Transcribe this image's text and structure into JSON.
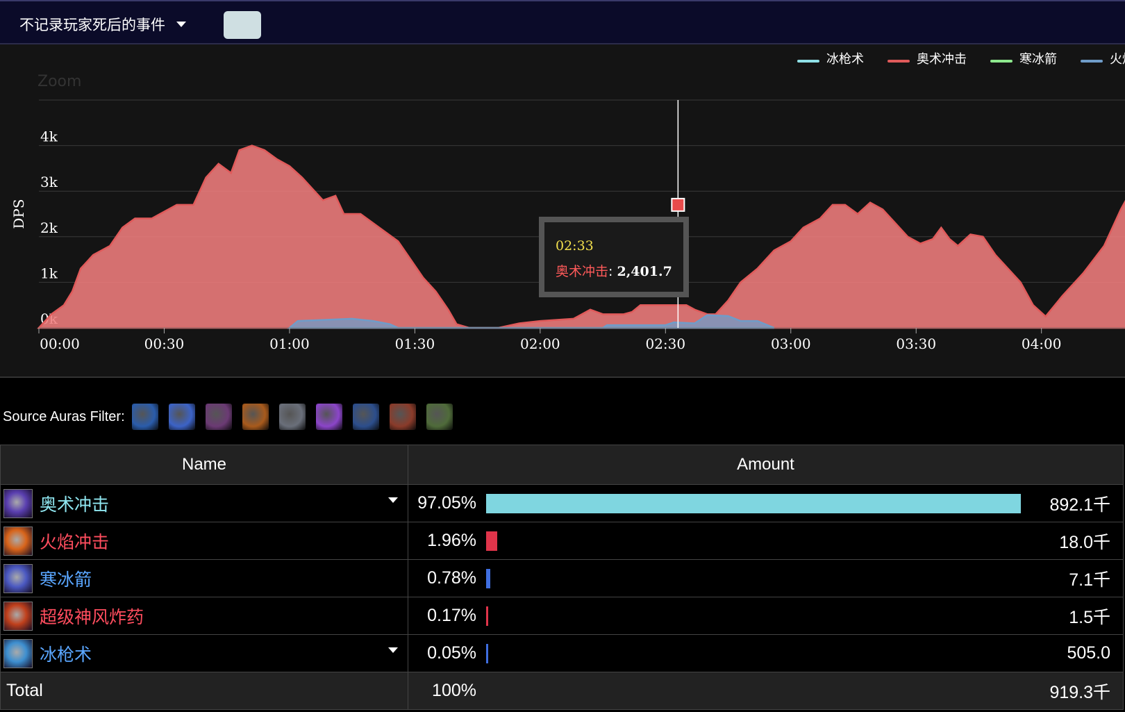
{
  "header": {
    "dropdown_label": "不记录玩家死后的事件"
  },
  "chart_data": {
    "type": "area",
    "zoom_label": "Zoom",
    "ylabel": "DPS",
    "ylim": [
      0,
      5000
    ],
    "yticks": [
      "0k",
      "1k",
      "2k",
      "3k",
      "4k"
    ],
    "xlim": [
      0,
      260
    ],
    "xticks": [
      "00:00",
      "00:30",
      "01:00",
      "01:30",
      "02:00",
      "02:30",
      "03:00",
      "03:30",
      "04:00"
    ],
    "legend_position": "top-right",
    "series": [
      {
        "name": "冰枪术",
        "color": "#8fe0e6",
        "values": []
      },
      {
        "name": "奥术冲击",
        "color": "#e05a5a",
        "points": [
          [
            0,
            0
          ],
          [
            3,
            300
          ],
          [
            6,
            500
          ],
          [
            8,
            800
          ],
          [
            10,
            1300
          ],
          [
            13,
            1600
          ],
          [
            17,
            1800
          ],
          [
            20,
            2200
          ],
          [
            23,
            2400
          ],
          [
            27,
            2400
          ],
          [
            29,
            2500
          ],
          [
            33,
            2700
          ],
          [
            37,
            2700
          ],
          [
            40,
            3300
          ],
          [
            43,
            3600
          ],
          [
            46,
            3400
          ],
          [
            48,
            3900
          ],
          [
            51,
            4000
          ],
          [
            54,
            3900
          ],
          [
            57,
            3700
          ],
          [
            60,
            3550
          ],
          [
            63,
            3300
          ],
          [
            66,
            3000
          ],
          [
            68,
            2800
          ],
          [
            71,
            2900
          ],
          [
            73,
            2500
          ],
          [
            77,
            2500
          ],
          [
            80,
            2300
          ],
          [
            83,
            2100
          ],
          [
            86,
            1900
          ],
          [
            89,
            1500
          ],
          [
            92,
            1100
          ],
          [
            95,
            800
          ],
          [
            98,
            400
          ],
          [
            100,
            80
          ],
          [
            103,
            0
          ],
          [
            110,
            0
          ],
          [
            115,
            100
          ],
          [
            120,
            150
          ],
          [
            128,
            200
          ],
          [
            129,
            250
          ],
          [
            132,
            400
          ],
          [
            135,
            300
          ],
          [
            140,
            300
          ],
          [
            142,
            350
          ],
          [
            144,
            500
          ],
          [
            155,
            500
          ],
          [
            157,
            400
          ],
          [
            160,
            300
          ],
          [
            162,
            300
          ],
          [
            165,
            600
          ],
          [
            168,
            1000
          ],
          [
            172,
            1300
          ],
          [
            176,
            1700
          ],
          [
            180,
            1900
          ],
          [
            183,
            2200
          ],
          [
            187,
            2400
          ],
          [
            190,
            2700
          ],
          [
            193,
            2700
          ],
          [
            196,
            2500
          ],
          [
            199,
            2750
          ],
          [
            202,
            2600
          ],
          [
            205,
            2300
          ],
          [
            208,
            2000
          ],
          [
            211,
            1850
          ],
          [
            214,
            1950
          ],
          [
            216,
            2200
          ],
          [
            218,
            1950
          ],
          [
            220,
            1800
          ],
          [
            223,
            2050
          ],
          [
            226,
            2000
          ],
          [
            229,
            1600
          ],
          [
            232,
            1300
          ],
          [
            235,
            1000
          ],
          [
            238,
            500
          ],
          [
            241,
            250
          ],
          [
            245,
            700
          ],
          [
            250,
            1200
          ],
          [
            255,
            1800
          ],
          [
            259,
            2600
          ],
          [
            262,
            3100
          ],
          [
            265,
            3350
          ],
          [
            268,
            3400
          ],
          [
            271,
            3500
          ],
          [
            274,
            3300
          ],
          [
            277,
            3050
          ],
          [
            281,
            2600
          ],
          [
            285,
            1800
          ],
          [
            288,
            800
          ],
          [
            291,
            300
          ]
        ]
      },
      {
        "name": "寒冰箭",
        "color": "#8ee88e",
        "values": []
      },
      {
        "name": "火焰冲击",
        "color": "#6f9cc9",
        "points": [
          [
            60,
            0
          ],
          [
            62,
            150
          ],
          [
            75,
            200
          ],
          [
            80,
            150
          ],
          [
            84,
            80
          ],
          [
            86,
            0
          ],
          [
            120,
            0
          ],
          [
            135,
            0
          ],
          [
            136,
            60
          ],
          [
            150,
            60
          ],
          [
            152,
            120
          ],
          [
            157,
            100
          ],
          [
            160,
            280
          ],
          [
            165,
            260
          ],
          [
            168,
            150
          ],
          [
            172,
            150
          ],
          [
            176,
            0
          ]
        ]
      }
    ],
    "tooltip": {
      "time": "02:33",
      "series_name": "奥术冲击",
      "value": "2,401.7"
    },
    "cursor_x": 153
  },
  "filter": {
    "label": "Source Auras Filter:",
    "auras": [
      {
        "icon": "frost-rune-icon",
        "color": "#2a5cab"
      },
      {
        "icon": "lightning-bolt-icon",
        "color": "#3c63c7"
      },
      {
        "icon": "priest-portrait-icon",
        "color": "#6b3a74"
      },
      {
        "icon": "flask-icon",
        "color": "#a85a1c"
      },
      {
        "icon": "helmet-icon",
        "color": "#6a6f7a"
      },
      {
        "icon": "purple-beam-icon",
        "color": "#8b45c9"
      },
      {
        "icon": "storm-orb-icon",
        "color": "#2c4e8c"
      },
      {
        "icon": "warrior-portrait-icon",
        "color": "#8a3b2a"
      },
      {
        "icon": "goblin-icon",
        "color": "#4f6b3a"
      }
    ]
  },
  "table": {
    "col_name": "Name",
    "col_amount": "Amount",
    "rows": [
      {
        "name": "奥术冲击",
        "color": "#8fe6f0",
        "pct": "97.05%",
        "fraction": 0.9705,
        "bar_color": "#7fd6e0",
        "amount": "892.1千",
        "icon": "arcane-blast-icon",
        "icon_color": "#5a3fb0",
        "expandable": true
      },
      {
        "name": "火焰冲击",
        "color": "#ff4d5e",
        "pct": "1.96%",
        "fraction": 0.0196,
        "bar_color": "#e0344a",
        "amount": "18.0千",
        "icon": "fire-blast-icon",
        "icon_color": "#d8641a",
        "expandable": false
      },
      {
        "name": "寒冰箭",
        "color": "#5aa6ff",
        "pct": "0.78%",
        "fraction": 0.0078,
        "bar_color": "#3f6ee0",
        "amount": "7.1千",
        "icon": "frostbolt-icon",
        "icon_color": "#4b59c2",
        "expandable": false
      },
      {
        "name": "超级神风炸药",
        "color": "#ff4d5e",
        "pct": "0.17%",
        "fraction": 0.0017,
        "bar_color": "#e0344a",
        "amount": "1.5千",
        "icon": "explosive-icon",
        "icon_color": "#c0401c",
        "expandable": false
      },
      {
        "name": "冰枪术",
        "color": "#5aa6ff",
        "pct": "0.05%",
        "fraction": 0.0005,
        "bar_color": "#3f6ee0",
        "amount": "505.0",
        "icon": "ice-lance-icon",
        "icon_color": "#3d8fd0",
        "expandable": true
      }
    ],
    "total": {
      "label": "Total",
      "pct": "100%",
      "amount": "919.3千"
    }
  }
}
